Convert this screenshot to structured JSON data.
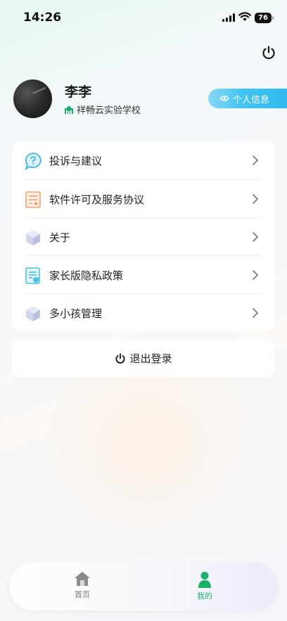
{
  "status_bar": {
    "time": "14:26",
    "battery": "76"
  },
  "profile": {
    "name": "李李",
    "school": "祥畅云实验学校",
    "info_button": "个人信息"
  },
  "menu": {
    "items": [
      {
        "label": "投诉与建议",
        "icon": "question-bubble-icon"
      },
      {
        "label": "软件许可及服务协议",
        "icon": "license-document-icon"
      },
      {
        "label": "关于",
        "icon": "cube-icon"
      },
      {
        "label": "家长版隐私政策",
        "icon": "privacy-document-icon"
      },
      {
        "label": "多小孩管理",
        "icon": "cube-icon"
      }
    ]
  },
  "logout": {
    "label": "退出登录"
  },
  "tabbar": {
    "items": [
      {
        "label": "首页",
        "icon": "home-icon",
        "active": false
      },
      {
        "label": "我的",
        "icon": "person-icon",
        "active": true
      }
    ]
  },
  "colors": {
    "accent_green": "#1db06a",
    "accent_blue": "#2fb7ec",
    "inactive_gray": "#777777"
  }
}
